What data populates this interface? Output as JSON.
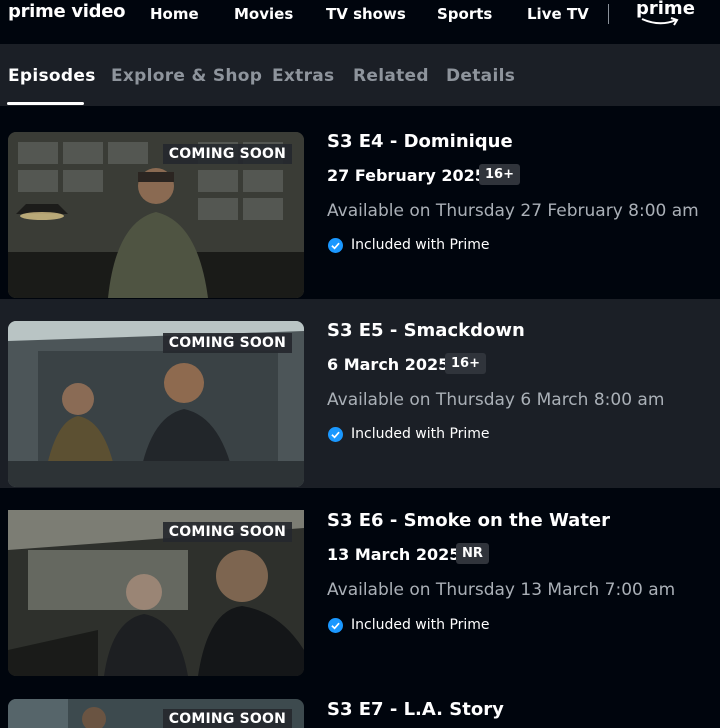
{
  "nav": {
    "logo": "prime video",
    "links": [
      "Home",
      "Movies",
      "TV shows",
      "Sports",
      "Live TV"
    ],
    "prime_badge": "prime"
  },
  "tabs": [
    "Episodes",
    "Explore & Shop",
    "Extras",
    "Related",
    "Details"
  ],
  "active_tab": "Episodes",
  "episodes": [
    {
      "title": "S3 E4 - Dominique",
      "date": "27 February 2025",
      "rating": "16+",
      "availability": "Available on Thursday 27 February 8:00 am",
      "included": "Included with Prime",
      "badge": "COMING SOON"
    },
    {
      "title": "S3 E5 - Smackdown",
      "date": "6 March 2025",
      "rating": "16+",
      "availability": "Available on Thursday 6 March 8:00 am",
      "included": "Included with Prime",
      "badge": "COMING SOON"
    },
    {
      "title": "S3 E6 - Smoke on the Water",
      "date": "13 March 2025",
      "rating": "NR",
      "availability": "Available on Thursday 13 March 7:00 am",
      "included": "Included with Prime",
      "badge": "COMING SOON"
    },
    {
      "title": "S3 E7 - L.A. Story",
      "badge": "COMING SOON"
    }
  ],
  "colors": {
    "background": "#00050d",
    "panel": "#1b1f26",
    "check": "#1a98ff",
    "muted_text": "#aab0b7"
  }
}
